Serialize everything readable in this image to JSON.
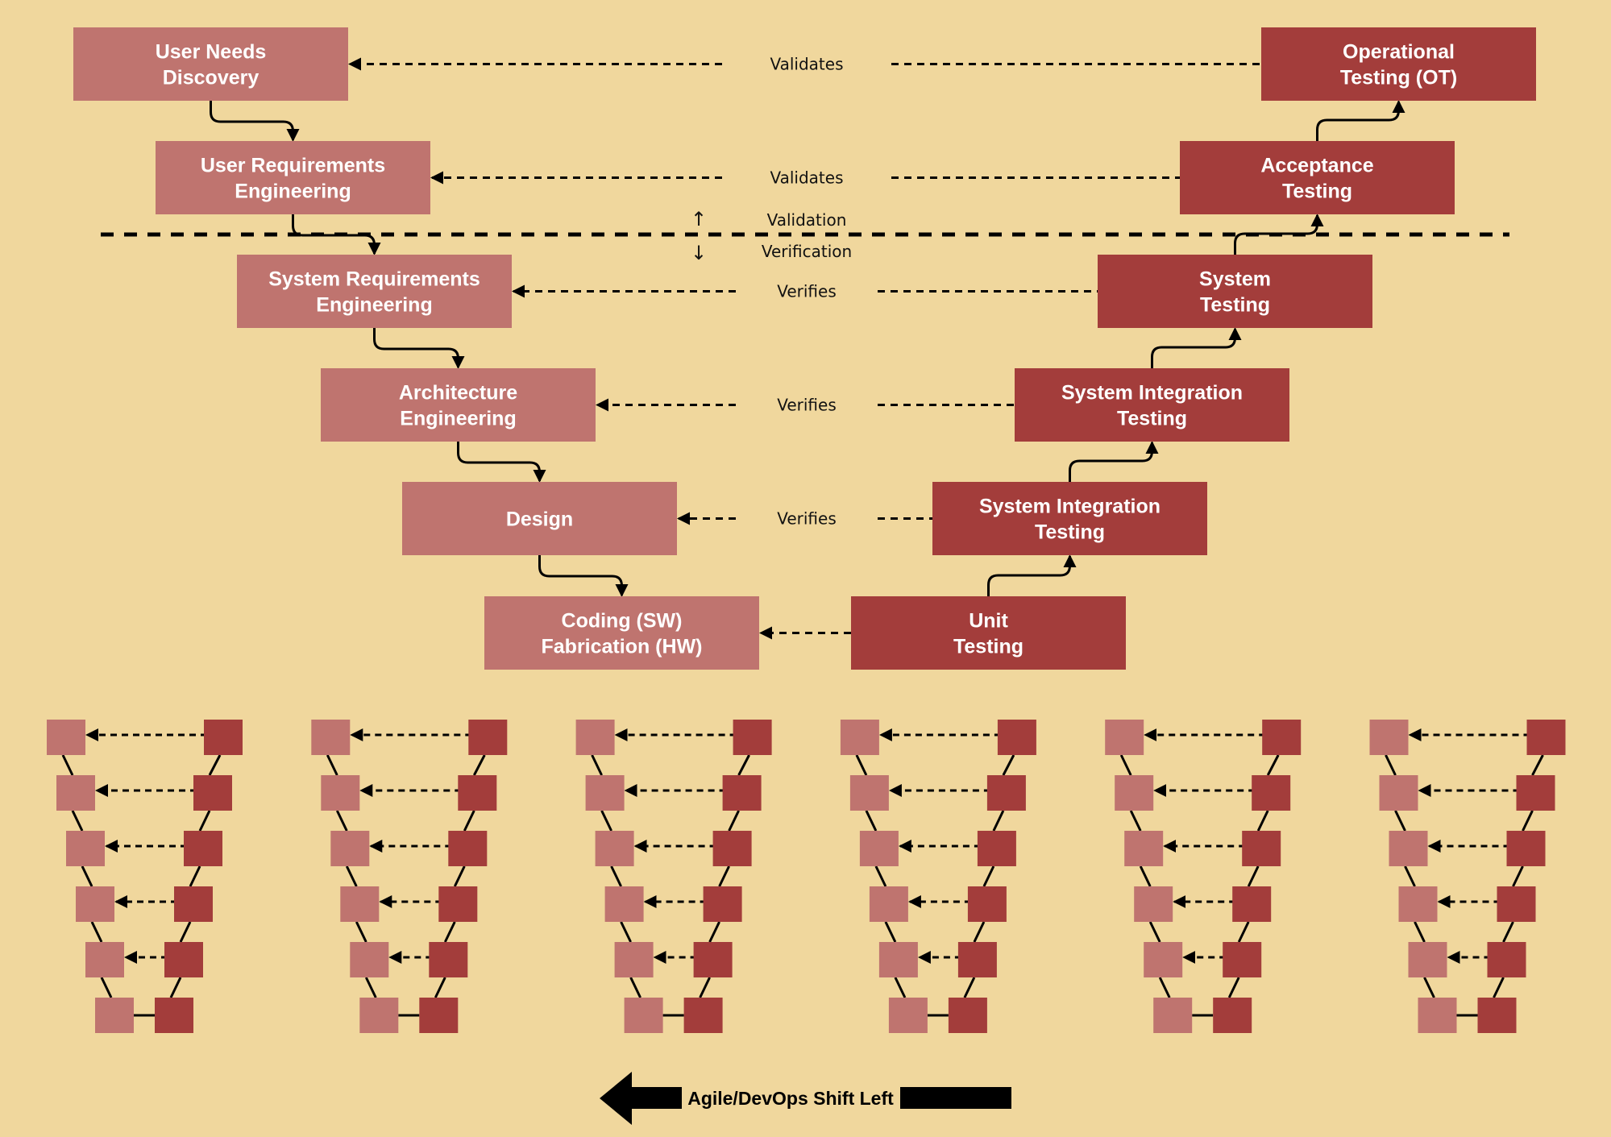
{
  "colors": {
    "background": "#F0D79D",
    "definition_box": "#BF746F",
    "testing_box": "#A33D3B",
    "box_text": "#FFFFFF",
    "line": "#000000"
  },
  "left_phases": [
    {
      "label": [
        "User Needs",
        "Discovery"
      ]
    },
    {
      "label": [
        "User Requirements",
        "Engineering"
      ]
    },
    {
      "label": [
        "System Requirements",
        "Engineering"
      ]
    },
    {
      "label": [
        "Architecture",
        "Engineering"
      ]
    },
    {
      "label": [
        "Design"
      ]
    },
    {
      "label": [
        "Coding (SW)",
        "Fabrication (HW)"
      ]
    }
  ],
  "right_phases": [
    {
      "label": [
        "Operational",
        "Testing (OT)"
      ]
    },
    {
      "label": [
        "Acceptance",
        "Testing"
      ]
    },
    {
      "label": [
        "System",
        "Testing"
      ]
    },
    {
      "label": [
        "System Integration",
        "Testing"
      ]
    },
    {
      "label": [
        "System Integration",
        "Testing"
      ]
    },
    {
      "label": [
        "Unit",
        "Testing"
      ]
    }
  ],
  "relations": [
    "Validates",
    "Validates",
    "Verifies",
    "Verifies",
    "Verifies",
    ""
  ],
  "boundary": {
    "upper_label": "Validation",
    "lower_label": "Verification",
    "up_icon": "↑",
    "down_icon": "↓"
  },
  "mini_v": {
    "count": 6,
    "levels": 6
  },
  "shift_arrow": {
    "label": "Agile/DevOps Shift Left",
    "direction": "left"
  }
}
